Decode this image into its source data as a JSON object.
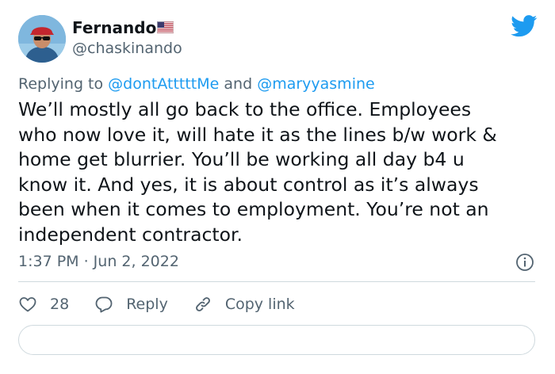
{
  "author": {
    "display_name": "Fernando",
    "handle": "@chaskinando",
    "flag_icon": "us-flag-icon"
  },
  "reply_context": {
    "prefix": "Replying to",
    "mention_1": "@dontAtttttMe",
    "joiner": "and",
    "mention_2": "@maryyasmine"
  },
  "tweet": {
    "lines": [
      "We’ll mostly all go back to the office. Employees",
      "who now love it, will hate it as the lines b/w work &",
      "home get blurrier. You’ll be working all day b4 u",
      "know it. And yes, it is about control as it’s always",
      "been when it comes to employment. You’re not an",
      "independent contractor."
    ],
    "timestamp": "1:37 PM · Jun 2, 2022"
  },
  "actions": {
    "like_count": "28",
    "reply_label": "Reply",
    "copy_link_label": "Copy link"
  },
  "colors": {
    "brand": "#1d9bf0",
    "text": "#0f1419",
    "secondary": "#536471",
    "border": "#cfd9de"
  }
}
